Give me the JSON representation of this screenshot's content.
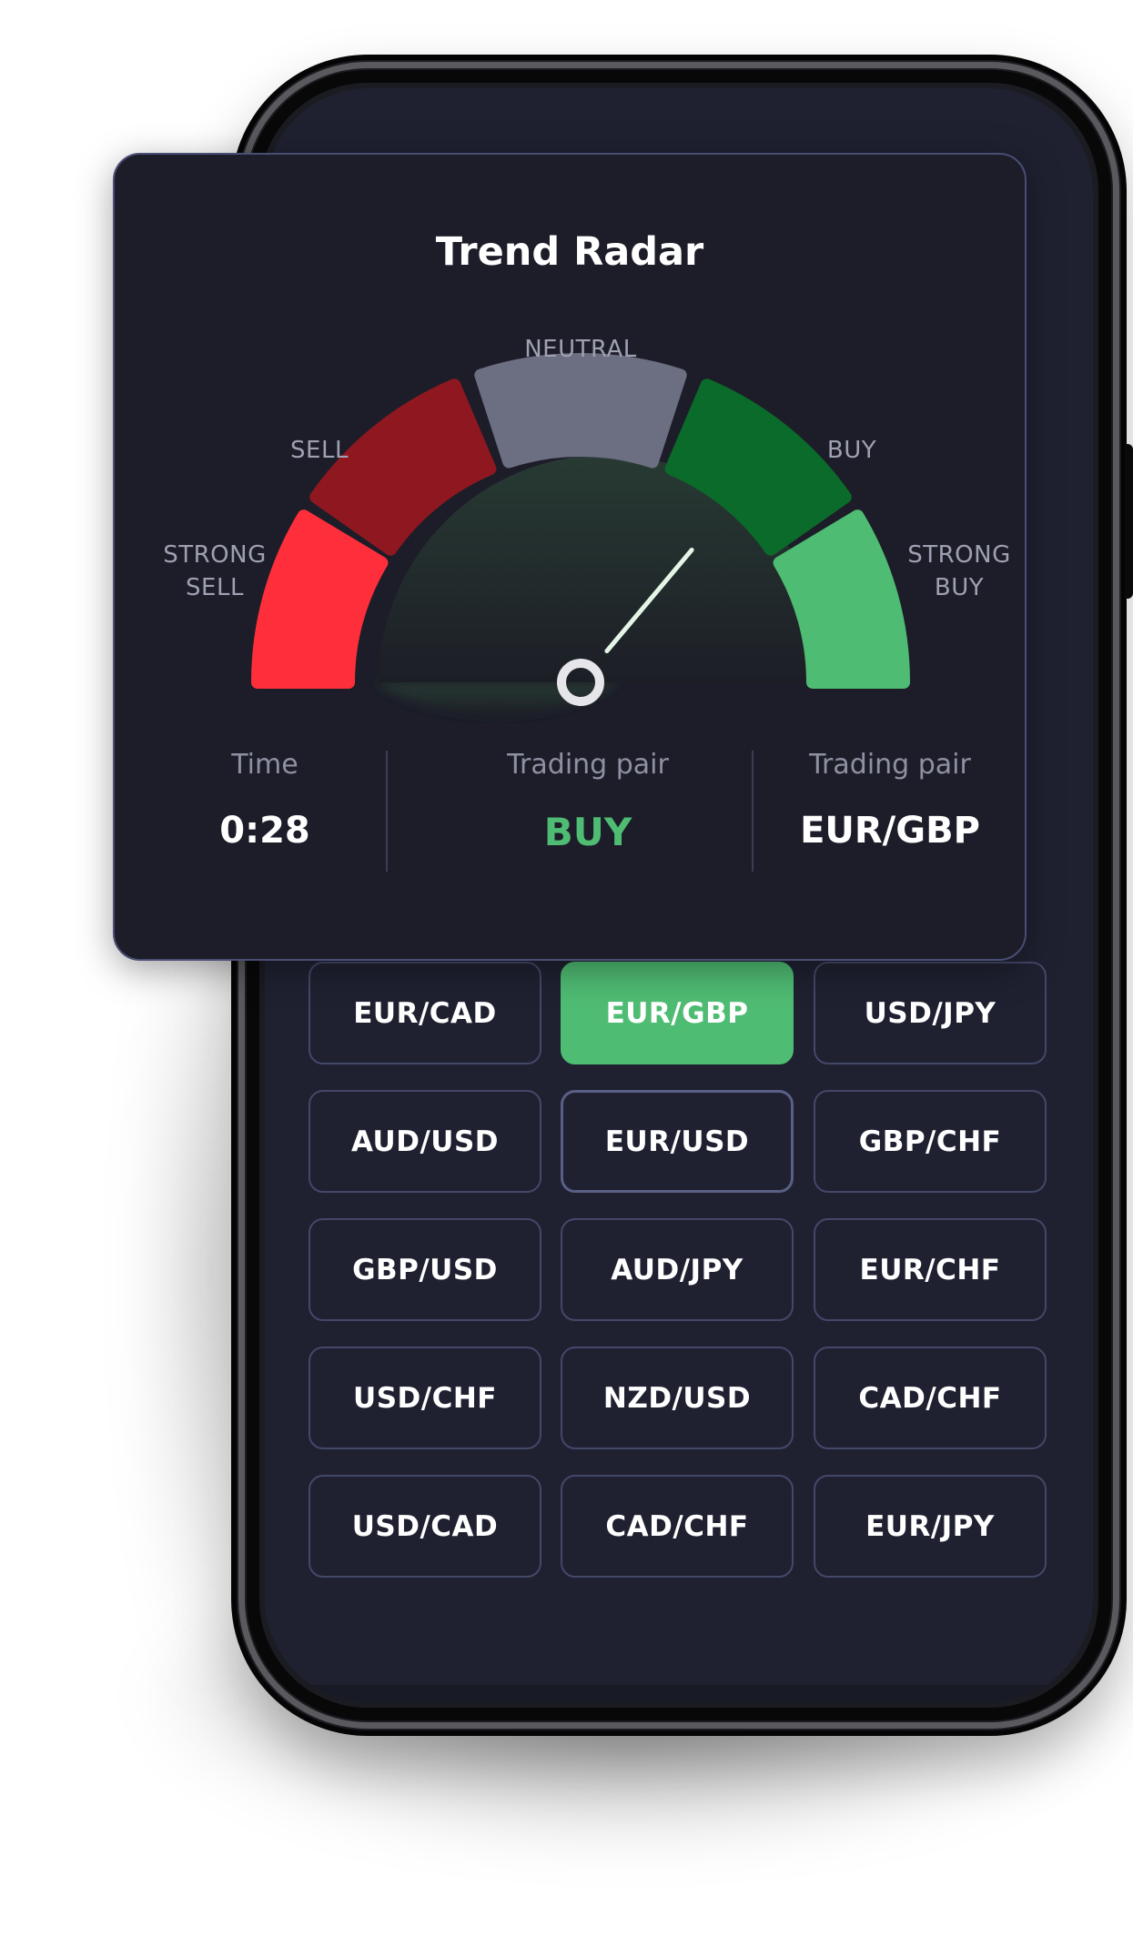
{
  "card": {
    "title": "Trend Radar",
    "gauge": {
      "labels": {
        "neutral": "NEUTRAL",
        "sell": "SELL",
        "buy": "BUY",
        "strong_sell": [
          "STRONG",
          "SELL"
        ],
        "strong_buy": [
          "STRONG",
          "BUY"
        ]
      },
      "segment_colors": {
        "strong_sell": "#fe2f3b",
        "sell": "#8f1820",
        "neutral": "#6c6e82",
        "buy": "#0a6b2b",
        "strong_buy": "#4fbc73"
      },
      "needle_color": "#e4f4e6",
      "active_zone": "BUY"
    },
    "stats": {
      "time": {
        "label": "Time",
        "value": "0:28"
      },
      "signal": {
        "label": "Trading pair",
        "value": "BUY",
        "color": "#4fbc73"
      },
      "pair": {
        "label": "Trading pair",
        "value": "EUR/GBP"
      }
    }
  },
  "pairs": {
    "selected": "EUR/GBP",
    "items": [
      "EUR/CAD",
      "EUR/GBP",
      "USD/JPY",
      "AUD/USD",
      "EUR/USD",
      "GBP/CHF",
      "GBP/USD",
      "AUD/JPY",
      "EUR/CHF",
      "USD/CHF",
      "NZD/USD",
      "CAD/CHF",
      "USD/CAD",
      "CAD/CHF",
      "EUR/JPY"
    ]
  }
}
